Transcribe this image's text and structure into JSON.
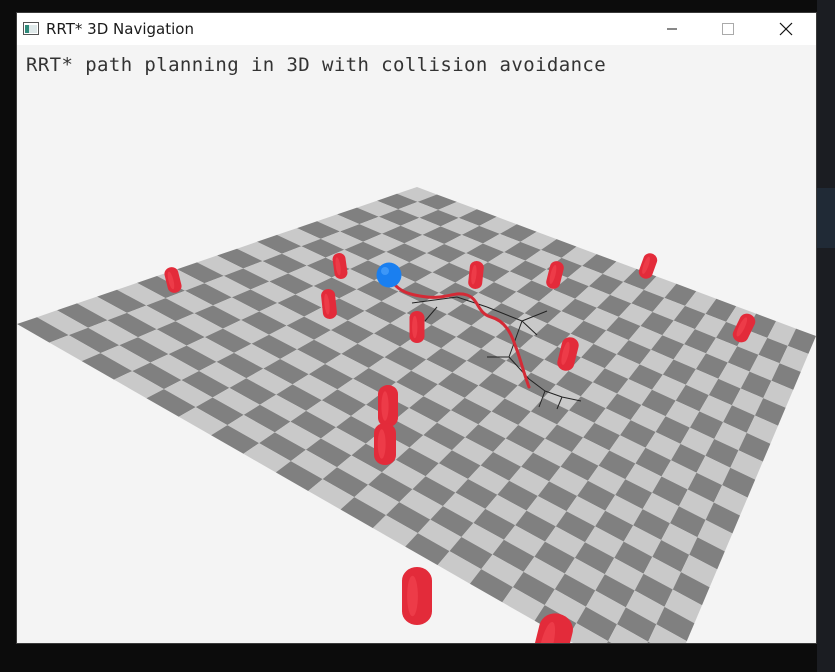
{
  "window": {
    "title": "RRT* 3D Navigation",
    "icon": "app-window-icon",
    "controls": [
      "minimize-icon",
      "maximize-icon",
      "close-icon"
    ]
  },
  "viewport": {
    "caption": "RRT* path planning in 3D with collision avoidance"
  },
  "colors": {
    "floor_light": "#c9c9c9",
    "floor_dark": "#808080",
    "obstacle": "#e32b3a",
    "path": "#d42a36",
    "agent": "#1a7ff0",
    "tree": "#222222",
    "background": "#f4f4f4"
  }
}
